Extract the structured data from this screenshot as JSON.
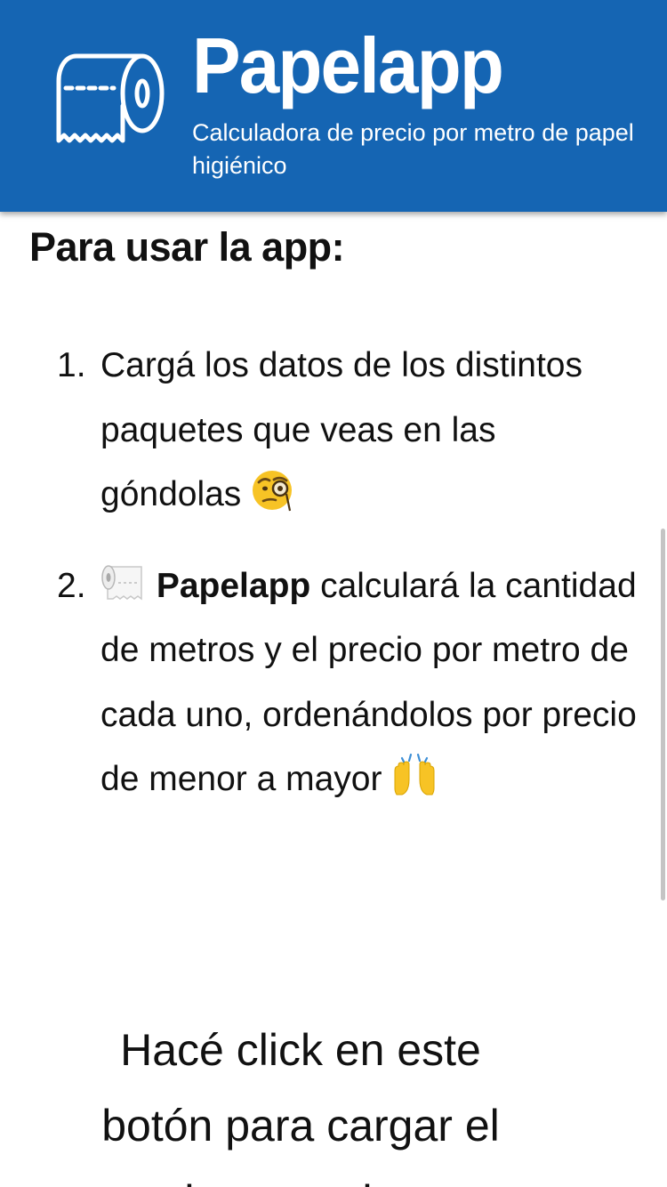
{
  "header": {
    "logo_icon": "toilet-paper-roll-icon",
    "title": "Papelapp",
    "subtitle": "Calculadora de precio por metro de papel higiénico",
    "background_color": "#1565b3"
  },
  "instructions": {
    "heading": "Para usar la app:",
    "steps": [
      {
        "number": "1.",
        "text": "Cargá los datos de los distintos paquetes que veas en las góndolas",
        "emoji": "face-with-monocle-emoji"
      },
      {
        "number": "2.",
        "leading_emoji": "toilet-paper-roll-emoji",
        "app_name": "Papelapp",
        "text": "calculará la cantidad de metros y el precio por metro de cada uno, ordenándolos por precio de menor a mayor",
        "emoji": "raising-hands-emoji"
      }
    ]
  },
  "cta": {
    "text": "Hacé click en este botón para cargar el primer producto"
  }
}
